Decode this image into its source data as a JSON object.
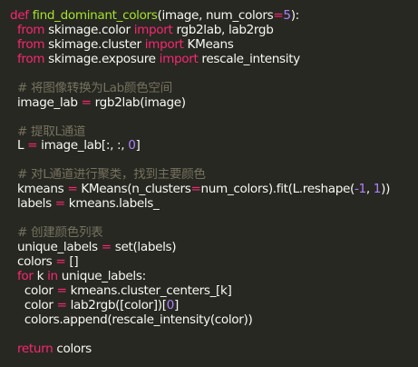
{
  "editor": {
    "background": "#272822",
    "colors": {
      "keyword": "#f92672",
      "function": "#a6e22e",
      "number": "#ae81ff",
      "operator": "#f92672",
      "comment": "#75715e",
      "text": "#f8f8f2",
      "parameter": "#fd971f",
      "attribute": "#66d9ef"
    },
    "lines": [
      [
        {
          "t": "def",
          "c": "kw"
        },
        {
          "t": " "
        },
        {
          "t": "find_dominant_colors",
          "c": "fn"
        },
        {
          "t": "(image, num_colors"
        },
        {
          "t": "=",
          "c": "op"
        },
        {
          "t": "5",
          "c": "num"
        },
        {
          "t": "):"
        }
      ],
      [
        {
          "t": "  "
        },
        {
          "t": "from",
          "c": "kw"
        },
        {
          "t": " skimage.color "
        },
        {
          "t": "import",
          "c": "kw"
        },
        {
          "t": " rgb2lab, lab2rgb"
        }
      ],
      [
        {
          "t": "  "
        },
        {
          "t": "from",
          "c": "kw"
        },
        {
          "t": " skimage.cluster "
        },
        {
          "t": "import",
          "c": "kw"
        },
        {
          "t": " KMeans"
        }
      ],
      [
        {
          "t": "  "
        },
        {
          "t": "from",
          "c": "kw"
        },
        {
          "t": " skimage.exposure "
        },
        {
          "t": "import",
          "c": "kw"
        },
        {
          "t": " rescale_intensity"
        }
      ],
      [
        {
          "t": ""
        }
      ],
      [
        {
          "t": "  "
        },
        {
          "t": "# 将图像转换为Lab颜色空间",
          "c": "com"
        }
      ],
      [
        {
          "t": "  image_lab "
        },
        {
          "t": "=",
          "c": "op"
        },
        {
          "t": " rgb2lab(image)"
        }
      ],
      [
        {
          "t": ""
        }
      ],
      [
        {
          "t": "  "
        },
        {
          "t": "# 提取L通道",
          "c": "com"
        }
      ],
      [
        {
          "t": "  L "
        },
        {
          "t": "=",
          "c": "op"
        },
        {
          "t": " image_lab[:, :, "
        },
        {
          "t": "0",
          "c": "num"
        },
        {
          "t": "]"
        }
      ],
      [
        {
          "t": ""
        }
      ],
      [
        {
          "t": "  "
        },
        {
          "t": "# 对L通道进行聚类，找到主要颜色",
          "c": "com"
        }
      ],
      [
        {
          "t": "  kmeans "
        },
        {
          "t": "=",
          "c": "op"
        },
        {
          "t": " KMeans(n_clusters"
        },
        {
          "t": "=",
          "c": "op"
        },
        {
          "t": "num_colors)."
        },
        {
          "t": "fit",
          "c": "id"
        },
        {
          "t": "(L."
        },
        {
          "t": "reshape",
          "c": "id"
        },
        {
          "t": "("
        },
        {
          "t": "-1",
          "c": "num"
        },
        {
          "t": ", "
        },
        {
          "t": "1",
          "c": "num"
        },
        {
          "t": "))"
        }
      ],
      [
        {
          "t": "  labels "
        },
        {
          "t": "=",
          "c": "op"
        },
        {
          "t": " kmeans.labels_"
        }
      ],
      [
        {
          "t": ""
        }
      ],
      [
        {
          "t": "  "
        },
        {
          "t": "# 创建颜色列表",
          "c": "com"
        }
      ],
      [
        {
          "t": "  unique_labels "
        },
        {
          "t": "=",
          "c": "op"
        },
        {
          "t": " set(labels)"
        }
      ],
      [
        {
          "t": "  colors "
        },
        {
          "t": "=",
          "c": "op"
        },
        {
          "t": " []"
        }
      ],
      [
        {
          "t": "  "
        },
        {
          "t": "for",
          "c": "kw"
        },
        {
          "t": " k "
        },
        {
          "t": "in",
          "c": "kw"
        },
        {
          "t": " unique_labels:"
        }
      ],
      [
        {
          "t": "    color "
        },
        {
          "t": "=",
          "c": "op"
        },
        {
          "t": " kmeans.cluster_centers_[k]"
        }
      ],
      [
        {
          "t": "    color "
        },
        {
          "t": "=",
          "c": "op"
        },
        {
          "t": " lab2rgb([color])["
        },
        {
          "t": "0",
          "c": "num"
        },
        {
          "t": "]"
        }
      ],
      [
        {
          "t": "    colors.append(rescale_intensity(color))"
        }
      ],
      [
        {
          "t": ""
        }
      ],
      [
        {
          "t": "  "
        },
        {
          "t": "return",
          "c": "kw"
        },
        {
          "t": " colors"
        }
      ]
    ]
  }
}
